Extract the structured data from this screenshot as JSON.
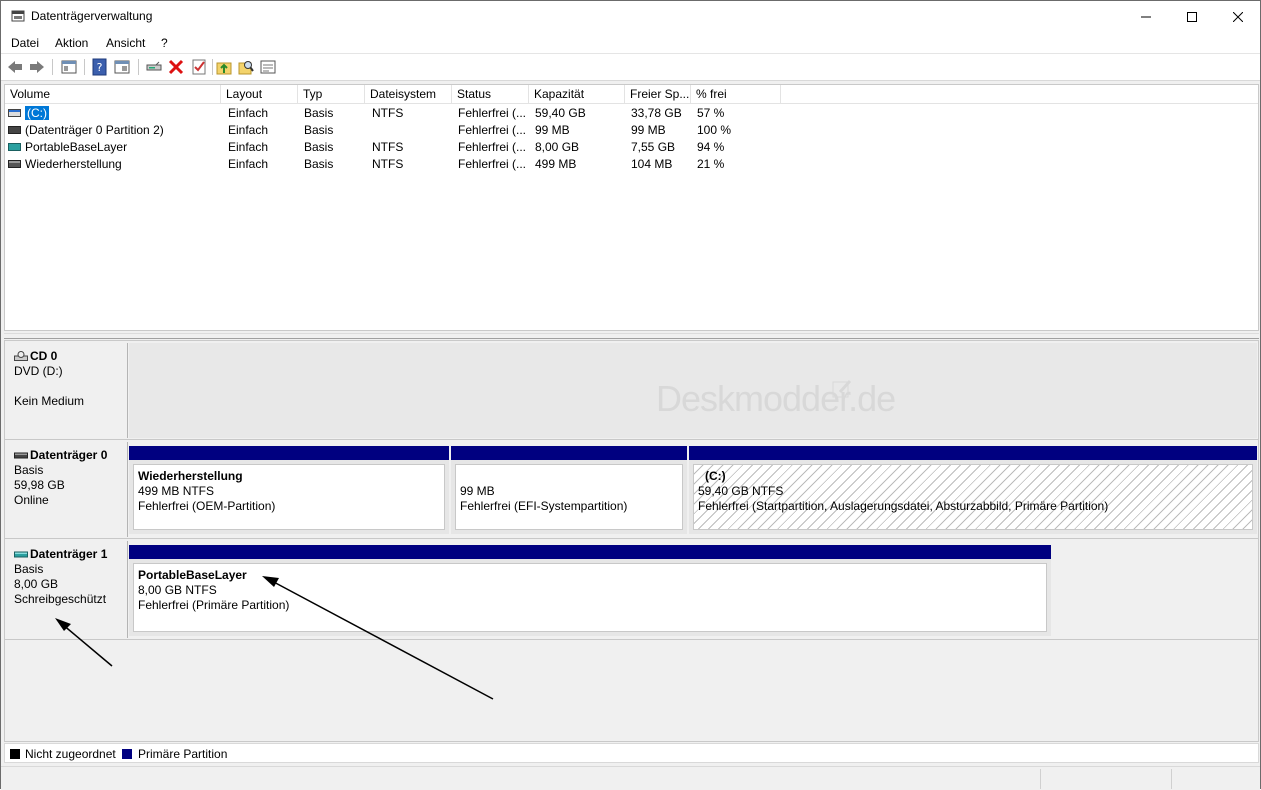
{
  "window": {
    "title": "Datenträgerverwaltung"
  },
  "menu": [
    "Datei",
    "Aktion",
    "Ansicht",
    "?"
  ],
  "toolbar": {
    "icons": [
      "back-icon",
      "forward-icon",
      "show-hide-console-tree-icon",
      "help-icon",
      "properties-icon",
      "connect-disk-icon",
      "delete-icon",
      "checklist-icon",
      "up-level-icon",
      "search-icon",
      "export-list-icon"
    ]
  },
  "volume_list": {
    "columns": [
      "Volume",
      "Layout",
      "Typ",
      "Dateisystem",
      "Status",
      "Kapazität",
      "Freier Sp...",
      "% frei"
    ],
    "rows": [
      {
        "volume": "(C:)",
        "layout": "Einfach",
        "typ": "Basis",
        "dateisystem": "NTFS",
        "status": "Fehlerfrei (...",
        "kapazitaet": "59,40 GB",
        "frei": "33,78 GB",
        "prozent": "57 %",
        "selected": true
      },
      {
        "volume": "(Datenträger 0 Partition 2)",
        "layout": "Einfach",
        "typ": "Basis",
        "dateisystem": "",
        "status": "Fehlerfrei (...",
        "kapazitaet": "99 MB",
        "frei": "99 MB",
        "prozent": "100 %",
        "selected": false
      },
      {
        "volume": "PortableBaseLayer",
        "layout": "Einfach",
        "typ": "Basis",
        "dateisystem": "NTFS",
        "status": "Fehlerfrei (...",
        "kapazitaet": "8,00 GB",
        "frei": "7,55 GB",
        "prozent": "94 %",
        "selected": false
      },
      {
        "volume": "Wiederherstellung",
        "layout": "Einfach",
        "typ": "Basis",
        "dateisystem": "NTFS",
        "status": "Fehlerfrei (...",
        "kapazitaet": "499 MB",
        "frei": "104 MB",
        "prozent": "21 %",
        "selected": false
      }
    ]
  },
  "disks": {
    "cd0": {
      "name": "CD 0",
      "line1": "DVD (D:)",
      "line2": "Kein Medium",
      "watermark": "Deskmodder.de"
    },
    "disk0": {
      "name": "Datenträger 0",
      "type": "Basis",
      "size": "59,98 GB",
      "state": "Online",
      "partitions": [
        {
          "name": "Wiederherstellung",
          "size": "499 MB NTFS",
          "status": "Fehlerfrei (OEM-Partition)"
        },
        {
          "name": "",
          "size": "99 MB",
          "status": "Fehlerfrei (EFI-Systempartition)"
        },
        {
          "name": "(C:)",
          "size": "59,40 GB NTFS",
          "status": "Fehlerfrei (Startpartition, Auslagerungsdatei, Absturzabbild, Primäre Partition)"
        }
      ]
    },
    "disk1": {
      "name": "Datenträger 1",
      "type": "Basis",
      "size": "8,00 GB",
      "state": "Schreibgeschützt",
      "partitions": [
        {
          "name": "PortableBaseLayer",
          "size": "8,00 GB NTFS",
          "status": "Fehlerfrei (Primäre Partition)"
        }
      ]
    }
  },
  "legend": [
    {
      "label": "Nicht zugeordnet",
      "color": "#000000"
    },
    {
      "label": "Primäre Partition",
      "color": "#000080"
    }
  ],
  "colors": {
    "primary_partition": "#000080",
    "selection": "#0078d7"
  }
}
